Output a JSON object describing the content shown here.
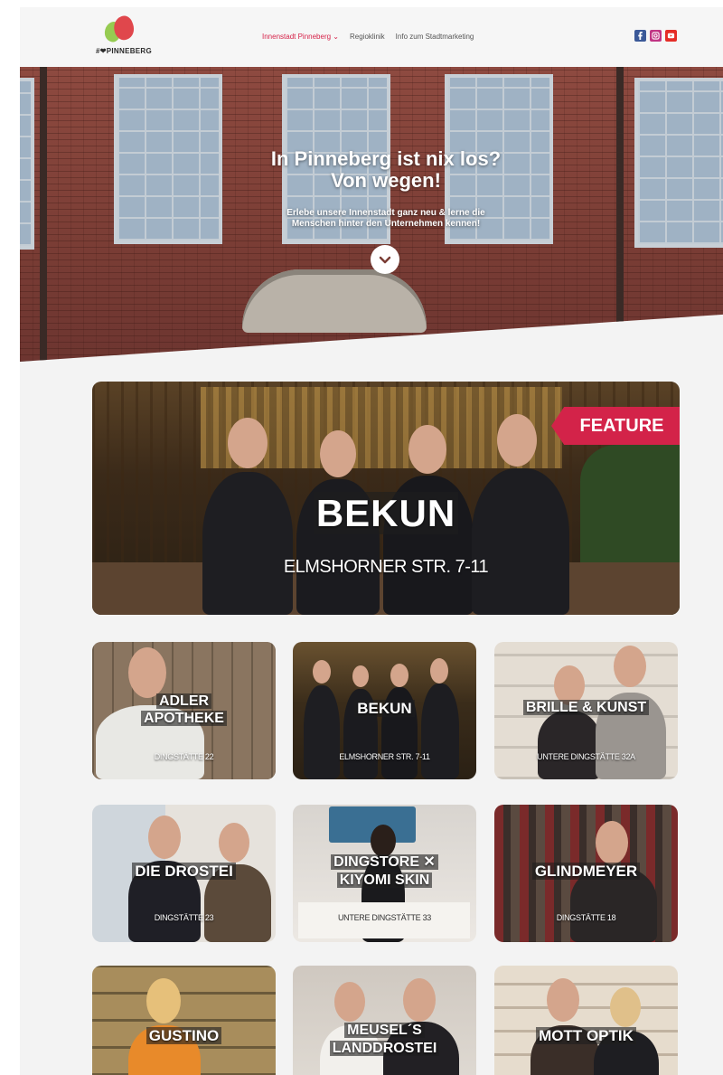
{
  "header": {
    "logo_text": "#❤PINNEBERG",
    "nav": [
      {
        "label": "Innenstadt Pinneberg ⌄",
        "active": true
      },
      {
        "label": "Regioklinik",
        "active": false
      },
      {
        "label": "Info zum Stadtmarketing",
        "active": false
      }
    ],
    "social": [
      {
        "icon": "facebook-icon",
        "color": "#3b5998"
      },
      {
        "icon": "instagram-icon",
        "color": "#c13584"
      },
      {
        "icon": "youtube-icon",
        "color": "#e52d27"
      }
    ]
  },
  "hero": {
    "title_line1": "In Pinneberg ist nix los?",
    "title_line2": "Von wegen!",
    "subtitle_line1": "Erlebe unsere Innenstadt ganz neu & lerne die",
    "subtitle_line2": "Menschen hinter den Unternehmen kennen!",
    "scroll_icon": "chevron-down-icon"
  },
  "feature": {
    "badge": "FEATURE",
    "name": "BEKUN",
    "address": "ELMSHORNER STR. 7-11",
    "accent": "#d32349"
  },
  "shops": [
    {
      "name_line1": "ADLER",
      "name_line2": "APOTHEKE",
      "address": "DINGSTÄTTE 22"
    },
    {
      "name_line1": "BEKUN",
      "name_line2": "",
      "address": "ELMSHORNER STR. 7-11"
    },
    {
      "name_line1": "BRILLE & KUNST",
      "name_line2": "",
      "address": "UNTERE DINGSTÄTTE 32A"
    },
    {
      "name_line1": "DIE DROSTEI",
      "name_line2": "",
      "address": "DINGSTÄTTE 23"
    },
    {
      "name_line1": "DINGSTORE ✕",
      "name_line2": "KIYOMI SKIN",
      "address": "UNTERE DINGSTÄTTE 33"
    },
    {
      "name_line1": "GLINDMEYER",
      "name_line2": "",
      "address": "DINGSTÄTTE 18"
    },
    {
      "name_line1": "GUSTINO",
      "name_line2": "",
      "address": ""
    },
    {
      "name_line1": "MEUSEL´S",
      "name_line2": "LANDDROSTEI",
      "address": ""
    },
    {
      "name_line1": "MOTT OPTIK",
      "name_line2": "",
      "address": ""
    }
  ]
}
